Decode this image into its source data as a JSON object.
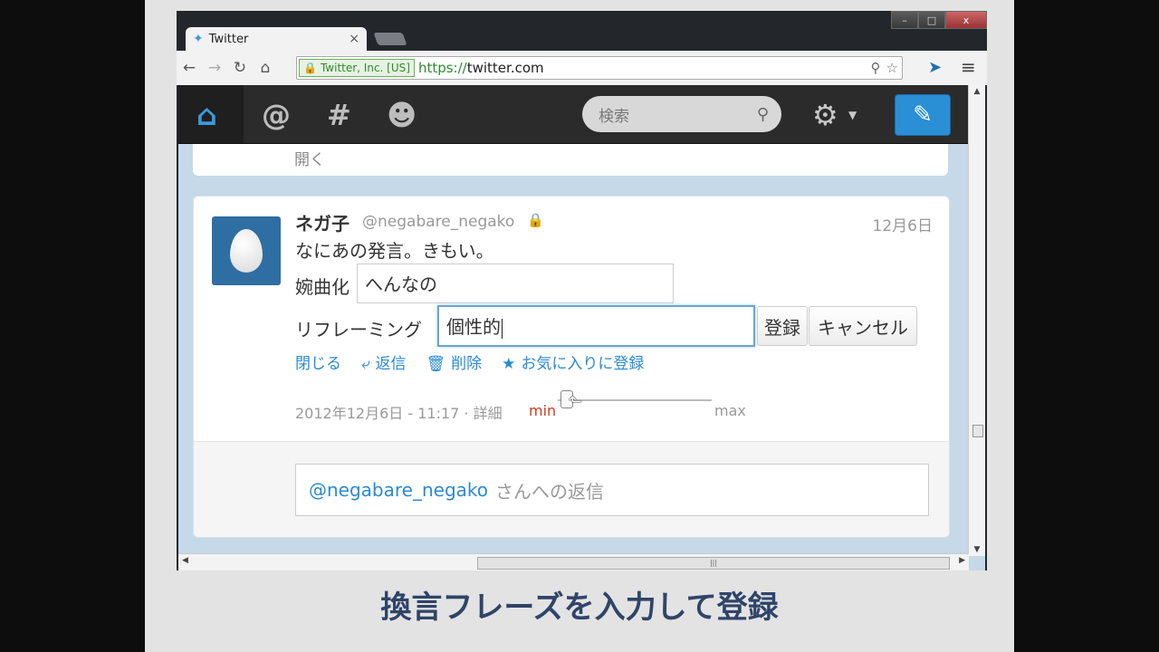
{
  "browser": {
    "tab_title": "Twitter",
    "tab_close": "×",
    "window_controls": {
      "minimize": "–",
      "maximize": "□",
      "close": "x"
    },
    "nav": {
      "back": "←",
      "forward": "→",
      "reload": "↻",
      "home": "⌂"
    },
    "ev_badge": "Twitter, Inc. [US]",
    "url_scheme": "https://",
    "url_host": "twitter.com"
  },
  "twitter_nav": {
    "search_placeholder": "検索",
    "icons": [
      "home-icon",
      "mention-icon",
      "hashtag-icon",
      "profile-icon",
      "gear-icon",
      "compose-icon"
    ]
  },
  "prev_tweet": {
    "expand_label": "開く"
  },
  "tweet": {
    "author_name": "ネガ子",
    "author_handle": "@negabare_negako",
    "date": "12月6日",
    "text": "なにあの発言。きもい。",
    "euphemism_label": "婉曲化",
    "euphemism_value": "へんなの",
    "reframing_label": "リフレーミング",
    "reframing_value": "個性的",
    "register_button": "登録",
    "cancel_button": "キャンセル",
    "actions": {
      "close": "閉じる",
      "reply": "返信",
      "delete": "削除",
      "favorite": "お気に入りに登録"
    },
    "timestamp": "2012年12月6日 - 11:17 · 詳細",
    "slider_min": "min",
    "slider_max": "max",
    "slider_value": 0.05
  },
  "reply": {
    "mention": "@negabare_negako",
    "suffix": "さんへの返信"
  },
  "caption": "換言フレーズを入力して登録",
  "colors": {
    "accent": "#2a8ad3",
    "min_label": "#d23a1c",
    "caption": "#2f4468",
    "compose": "#2a8fd4"
  }
}
